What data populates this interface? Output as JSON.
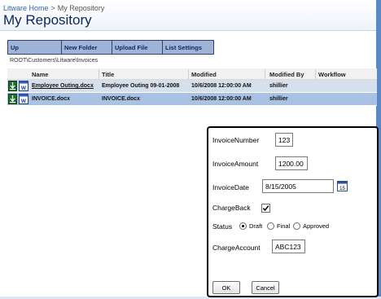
{
  "breadcrumb": {
    "home": "Litware Home",
    "separator": ">",
    "current": "My Repository"
  },
  "page_title": "My Repository",
  "toolbar": {
    "up": "Up",
    "new_folder": "New Folder",
    "upload_file": "Upload File",
    "list_settings": "List Settings"
  },
  "path": "ROOT\\Customers\\Litware\\Invoices",
  "grid": {
    "columns": {
      "name": "Name",
      "title": "Title",
      "modified": "Modified",
      "modified_by": "Modified By",
      "workflow": "Workflow"
    },
    "rows": [
      {
        "name": "Employee Outing.docx",
        "title": "Employee Outing 09-01-2008",
        "modified": "10/6/2008 12:00:00 AM",
        "modified_by": "shillier",
        "workflow": ""
      },
      {
        "name": "INVOICE.docx",
        "title": "INVOICE.docx",
        "modified": "10/6/2008 12:00:00 AM",
        "modified_by": "shillier",
        "workflow": ""
      }
    ]
  },
  "form": {
    "invoice_number": {
      "label": "InvoiceNumber",
      "value": "123"
    },
    "invoice_amount": {
      "label": "InvoiceAmount",
      "value": "1200.00"
    },
    "invoice_date": {
      "label": "InvoiceDate",
      "value": "8/15/2005",
      "calendar_day": "15"
    },
    "charge_back": {
      "label": "ChargeBack",
      "checked": true
    },
    "status": {
      "label": "Status",
      "options": [
        {
          "label": "Draft",
          "selected": true
        },
        {
          "label": "Final",
          "selected": false
        },
        {
          "label": "Approved",
          "selected": false
        }
      ]
    },
    "charge_account": {
      "label": "ChargeAccount",
      "value": "ABC123"
    },
    "ok_label": "OK",
    "cancel_label": "Cancel"
  },
  "colors": {
    "title": "#10245a",
    "toolbar_bg": "#9eb3d6",
    "selected_row": "#a9c2e4",
    "accent_strip": "#5a88c6"
  }
}
